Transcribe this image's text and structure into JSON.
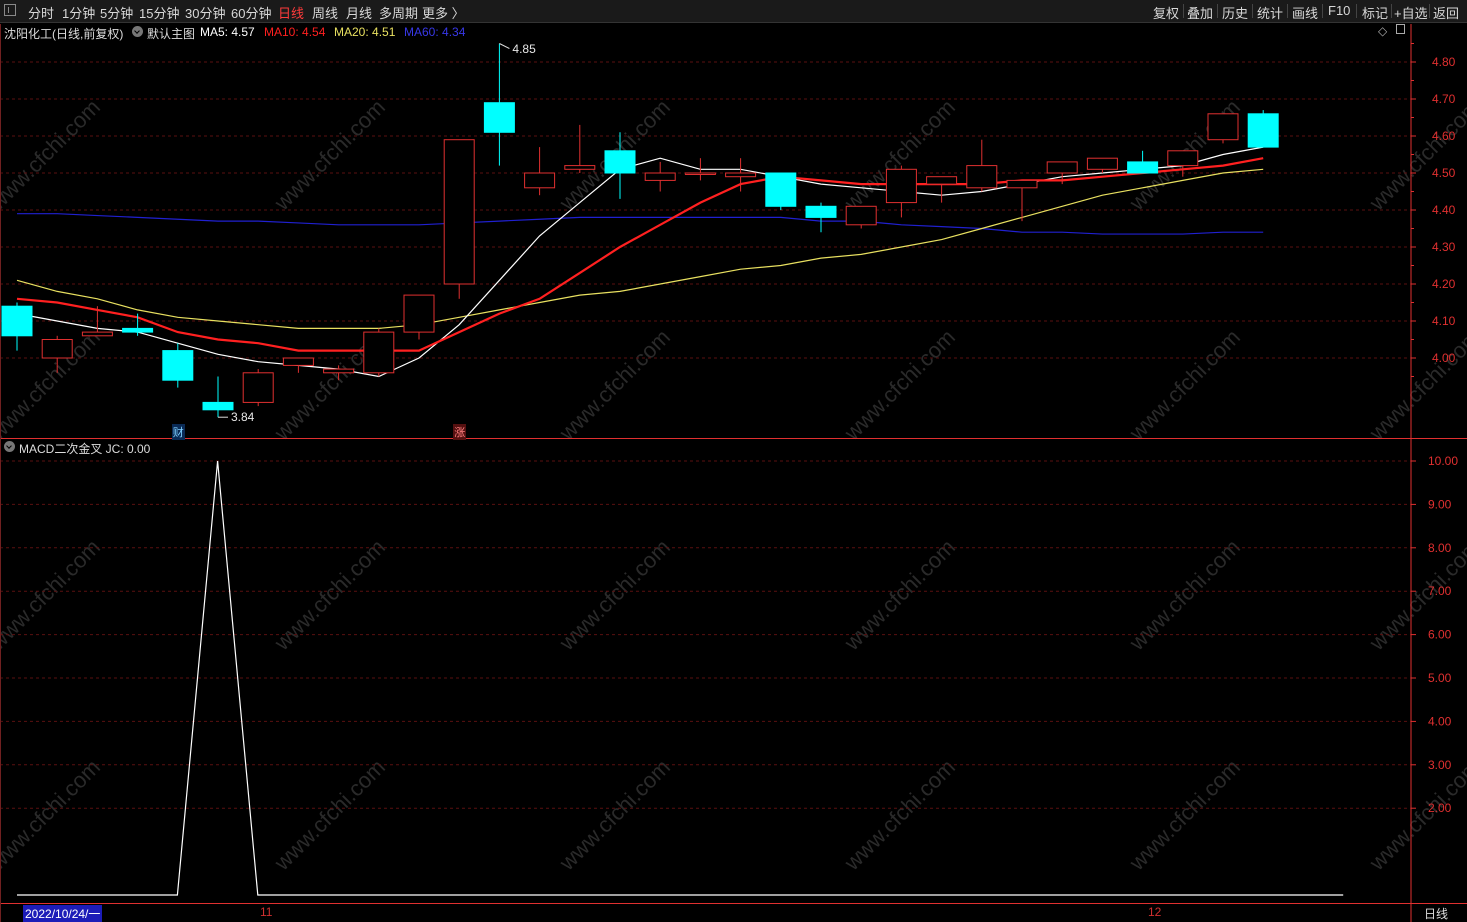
{
  "toolbar": {
    "periods": [
      "分时",
      "1分钟",
      "5分钟",
      "15分钟",
      "30分钟",
      "60分钟",
      "日线",
      "周线",
      "月线",
      "多周期",
      "更多 〉"
    ],
    "active_period": "日线",
    "tools": [
      "复权",
      "叠加",
      "历史",
      "统计",
      "画线",
      "F10",
      "标记",
      "+自选",
      "返回"
    ]
  },
  "main_panel": {
    "stock_name": "沈阳化工",
    "mode": "(日线,前复权)",
    "template": "默认主图",
    "ma5_label": "MA5: 4.57",
    "ma10_label": "MA10: 4.54",
    "ma20_label": "MA20: 4.51",
    "ma60_label": "MA60: 4.34",
    "high_label": "4.85",
    "low_label": "3.84",
    "marker_cai": "财",
    "marker_zhang": "涨"
  },
  "sub_panel": {
    "indicator_label": "MACD二次金叉  JC: 0.00"
  },
  "bottom": {
    "date_label": "2022/10/24/一",
    "month_11": "11",
    "month_12": "12",
    "period_button": "日线"
  },
  "watermark": "www.cfchi.com",
  "colors": {
    "up": "#e03030",
    "down": "#00ffff",
    "ma5": "#ffffff",
    "ma10": "#ff2020",
    "ma20": "#e8e060",
    "ma60": "#2020d0",
    "axis": "#e03030"
  },
  "chart_data": [
    {
      "type": "candlestick",
      "title": "沈阳化工 (日线,前复权)",
      "ylim": [
        3.78,
        4.9
      ],
      "y_ticks": [
        4.0,
        4.1,
        4.2,
        4.3,
        4.4,
        4.5,
        4.6,
        4.7,
        4.8
      ],
      "candles": [
        {
          "o": 4.14,
          "h": 4.15,
          "l": 4.02,
          "c": 4.06
        },
        {
          "o": 4.0,
          "h": 4.06,
          "l": 3.96,
          "c": 4.05
        },
        {
          "o": 4.06,
          "h": 4.14,
          "l": 4.06,
          "c": 4.07
        },
        {
          "o": 4.08,
          "h": 4.12,
          "l": 4.06,
          "c": 4.07
        },
        {
          "o": 4.02,
          "h": 4.04,
          "l": 3.92,
          "c": 3.94
        },
        {
          "o": 3.88,
          "h": 3.95,
          "l": 3.84,
          "c": 3.86
        },
        {
          "o": 3.88,
          "h": 3.97,
          "l": 3.87,
          "c": 3.96
        },
        {
          "o": 3.98,
          "h": 4.0,
          "l": 3.96,
          "c": 4.0
        },
        {
          "o": 3.96,
          "h": 3.98,
          "l": 3.94,
          "c": 3.97
        },
        {
          "o": 3.96,
          "h": 4.08,
          "l": 3.95,
          "c": 4.07
        },
        {
          "o": 4.07,
          "h": 4.17,
          "l": 4.05,
          "c": 4.17
        },
        {
          "o": 4.2,
          "h": 4.59,
          "l": 4.16,
          "c": 4.59
        },
        {
          "o": 4.69,
          "h": 4.85,
          "l": 4.52,
          "c": 4.61
        },
        {
          "o": 4.46,
          "h": 4.57,
          "l": 4.44,
          "c": 4.5
        },
        {
          "o": 4.51,
          "h": 4.63,
          "l": 4.5,
          "c": 4.52
        },
        {
          "o": 4.56,
          "h": 4.61,
          "l": 4.43,
          "c": 4.5
        },
        {
          "o": 4.48,
          "h": 4.53,
          "l": 4.45,
          "c": 4.5
        },
        {
          "o": 4.5,
          "h": 4.54,
          "l": 4.48,
          "c": 4.5
        },
        {
          "o": 4.49,
          "h": 4.54,
          "l": 4.45,
          "c": 4.5
        },
        {
          "o": 4.5,
          "h": 4.5,
          "l": 4.4,
          "c": 4.41
        },
        {
          "o": 4.41,
          "h": 4.42,
          "l": 4.34,
          "c": 4.38
        },
        {
          "o": 4.36,
          "h": 4.41,
          "l": 4.35,
          "c": 4.41
        },
        {
          "o": 4.42,
          "h": 4.52,
          "l": 4.38,
          "c": 4.51
        },
        {
          "o": 4.47,
          "h": 4.49,
          "l": 4.42,
          "c": 4.49
        },
        {
          "o": 4.46,
          "h": 4.59,
          "l": 4.45,
          "c": 4.52
        },
        {
          "o": 4.46,
          "h": 4.48,
          "l": 4.37,
          "c": 4.48
        },
        {
          "o": 4.5,
          "h": 4.53,
          "l": 4.47,
          "c": 4.53
        },
        {
          "o": 4.51,
          "h": 4.54,
          "l": 4.5,
          "c": 4.54
        },
        {
          "o": 4.53,
          "h": 4.56,
          "l": 4.5,
          "c": 4.5
        },
        {
          "o": 4.52,
          "h": 4.56,
          "l": 4.49,
          "c": 4.56
        },
        {
          "o": 4.59,
          "h": 4.66,
          "l": 4.58,
          "c": 4.66
        },
        {
          "o": 4.66,
          "h": 4.67,
          "l": 4.57,
          "c": 4.57
        }
      ],
      "ma5": [
        4.12,
        4.1,
        4.08,
        4.07,
        4.04,
        4.01,
        3.99,
        3.98,
        3.97,
        3.95,
        4.0,
        4.09,
        4.21,
        4.33,
        4.42,
        4.51,
        4.54,
        4.51,
        4.51,
        4.49,
        4.47,
        4.46,
        4.45,
        4.44,
        4.45,
        4.47,
        4.49,
        4.5,
        4.51,
        4.52,
        4.55,
        4.57
      ],
      "ma10": [
        4.16,
        4.15,
        4.13,
        4.11,
        4.07,
        4.05,
        4.04,
        4.02,
        4.02,
        4.02,
        4.02,
        4.07,
        4.12,
        4.16,
        4.23,
        4.3,
        4.36,
        4.42,
        4.47,
        4.49,
        4.48,
        4.47,
        4.47,
        4.47,
        4.47,
        4.48,
        4.48,
        4.49,
        4.5,
        4.51,
        4.52,
        4.54
      ],
      "ma20": [
        4.21,
        4.18,
        4.16,
        4.13,
        4.11,
        4.1,
        4.09,
        4.08,
        4.08,
        4.08,
        4.09,
        4.11,
        4.13,
        4.15,
        4.17,
        4.18,
        4.2,
        4.22,
        4.24,
        4.25,
        4.27,
        4.28,
        4.3,
        4.32,
        4.35,
        4.38,
        4.41,
        4.44,
        4.46,
        4.48,
        4.5,
        4.51
      ],
      "ma60": [
        4.39,
        4.39,
        4.385,
        4.38,
        4.375,
        4.37,
        4.37,
        4.365,
        4.36,
        4.36,
        4.36,
        4.365,
        4.37,
        4.375,
        4.38,
        4.38,
        4.38,
        4.38,
        4.38,
        4.38,
        4.37,
        4.37,
        4.36,
        4.355,
        4.35,
        4.34,
        4.34,
        4.335,
        4.335,
        4.335,
        4.34,
        4.34
      ]
    },
    {
      "type": "line",
      "title": "MACD二次金叉  JC: 0.00",
      "ylim": [
        0,
        10.5
      ],
      "y_ticks": [
        2.0,
        3.0,
        4.0,
        5.0,
        6.0,
        7.0,
        8.0,
        9.0,
        10.0
      ],
      "values": [
        0,
        0,
        0,
        10,
        0,
        0,
        0,
        0,
        0,
        0,
        0,
        0,
        0,
        0,
        0,
        0,
        0,
        0,
        0,
        0,
        0,
        0,
        0,
        0,
        0,
        0,
        0,
        0,
        0,
        0,
        0,
        0
      ]
    }
  ]
}
